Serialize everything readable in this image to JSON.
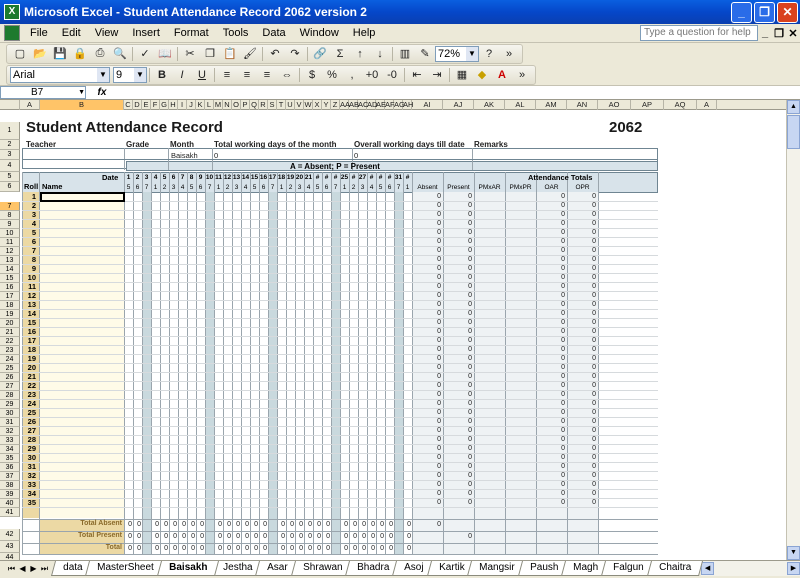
{
  "window": {
    "title": "Microsoft Excel - Student Attendance Record 2062 version 2",
    "minimize": "_",
    "restore": "❐",
    "close": "✕"
  },
  "menu": {
    "items": [
      "File",
      "Edit",
      "View",
      "Insert",
      "Format",
      "Tools",
      "Data",
      "Window",
      "Help"
    ],
    "help_placeholder": "Type a question for help",
    "doc_min": "_",
    "doc_restore": "❐",
    "doc_close": "✕"
  },
  "toolbar": {
    "zoom": "72%"
  },
  "format_toolbar": {
    "font": "Arial",
    "size": "9"
  },
  "formula_bar": {
    "name_box": "B7",
    "fx": "fx",
    "value": ""
  },
  "columns": [
    {
      "label": "A",
      "w": 20
    },
    {
      "label": "B",
      "w": 84
    },
    {
      "label": "C",
      "w": 9
    },
    {
      "label": "D",
      "w": 9
    },
    {
      "label": "E",
      "w": 9
    },
    {
      "label": "F",
      "w": 9
    },
    {
      "label": "G",
      "w": 9
    },
    {
      "label": "H",
      "w": 9
    },
    {
      "label": "I",
      "w": 9
    },
    {
      "label": "J",
      "w": 9
    },
    {
      "label": "K",
      "w": 9
    },
    {
      "label": "L",
      "w": 9
    },
    {
      "label": "M",
      "w": 9
    },
    {
      "label": "N",
      "w": 9
    },
    {
      "label": "O",
      "w": 9
    },
    {
      "label": "P",
      "w": 9
    },
    {
      "label": "Q",
      "w": 9
    },
    {
      "label": "R",
      "w": 9
    },
    {
      "label": "S",
      "w": 9
    },
    {
      "label": "T",
      "w": 9
    },
    {
      "label": "U",
      "w": 9
    },
    {
      "label": "V",
      "w": 9
    },
    {
      "label": "W",
      "w": 9
    },
    {
      "label": "X",
      "w": 9
    },
    {
      "label": "Y",
      "w": 9
    },
    {
      "label": "Z",
      "w": 9
    },
    {
      "label": "AA",
      "w": 9
    },
    {
      "label": "AB",
      "w": 9
    },
    {
      "label": "AC",
      "w": 9
    },
    {
      "label": "AD",
      "w": 9
    },
    {
      "label": "AE",
      "w": 9
    },
    {
      "label": "AF",
      "w": 9
    },
    {
      "label": "AG",
      "w": 9
    },
    {
      "label": "AH",
      "w": 9
    },
    {
      "label": "AI",
      "w": 31
    },
    {
      "label": "AJ",
      "w": 31
    },
    {
      "label": "AK",
      "w": 31
    },
    {
      "label": "AL",
      "w": 31
    },
    {
      "label": "AM",
      "w": 31
    },
    {
      "label": "AN",
      "w": 31
    },
    {
      "label": "AO",
      "w": 33
    },
    {
      "label": "AP",
      "w": 33
    },
    {
      "label": "AQ",
      "w": 33
    },
    {
      "label": "A",
      "w": 20
    }
  ],
  "sheet": {
    "title": "Student Attendance Record",
    "year": "2062",
    "labels": {
      "teacher": "Teacher",
      "grade": "Grade",
      "month": "Month",
      "working_days": "Total working days of the month",
      "overall_days": "Overall working days till date",
      "remarks": "Remarks"
    },
    "values": {
      "month": "Baisakh",
      "working_days": "0",
      "overall_days": "0"
    },
    "legend": "A = Absent;   P = Present",
    "date_label": "Date",
    "dates": [
      "1",
      "2",
      "3",
      "4",
      "5",
      "6",
      "7",
      "8",
      "9",
      "10",
      "11",
      "12",
      "13",
      "14",
      "15",
      "16",
      "17",
      "18",
      "19",
      "20",
      "21",
      "#",
      "#",
      "#",
      "25",
      "#",
      "27",
      "#",
      "#",
      "#",
      "31",
      "#"
    ],
    "weekdays": [
      "5",
      "6",
      "7",
      "1",
      "2",
      "3",
      "4",
      "5",
      "6",
      "7",
      "1",
      "2",
      "3",
      "4",
      "5",
      "6",
      "7",
      "1",
      "2",
      "3",
      "4",
      "5",
      "6",
      "7",
      "1",
      "2",
      "3",
      "4",
      "5",
      "6",
      "7",
      "1"
    ],
    "roll_header": "Roll",
    "name_header": "Name",
    "totals_header": "Attendance Totals",
    "total_cols": [
      "Absent",
      "Present",
      "PMxAR",
      "PMxPR",
      "OAR",
      "OPR"
    ],
    "rows": [
      "1",
      "2",
      "3",
      "4",
      "5",
      "6",
      "7",
      "8",
      "9",
      "10",
      "11",
      "12",
      "13",
      "14",
      "15",
      "16",
      "17",
      "18",
      "19",
      "20",
      "21",
      "22",
      "23",
      "24",
      "25",
      "26",
      "27",
      "28",
      "29",
      "30",
      "31",
      "32",
      "33",
      "34",
      "35"
    ],
    "total_absent": "Total Absent",
    "total_present": "Total Present",
    "total": "Total",
    "zero": "0"
  },
  "sheet_tabs": [
    "data",
    "MasterSheet",
    "Baisakh",
    "Jestha",
    "Asar",
    "Shrawan",
    "Bhadra",
    "Asoj",
    "Kartik",
    "Mangsir",
    "Paush",
    "Magh",
    "Falgun",
    "Chaitra"
  ],
  "active_tab": "Baisakh",
  "colors": {
    "header_tan": "#ecd9a4",
    "band_blue": "#d8e3ea",
    "grid_line": "#6f8592"
  }
}
